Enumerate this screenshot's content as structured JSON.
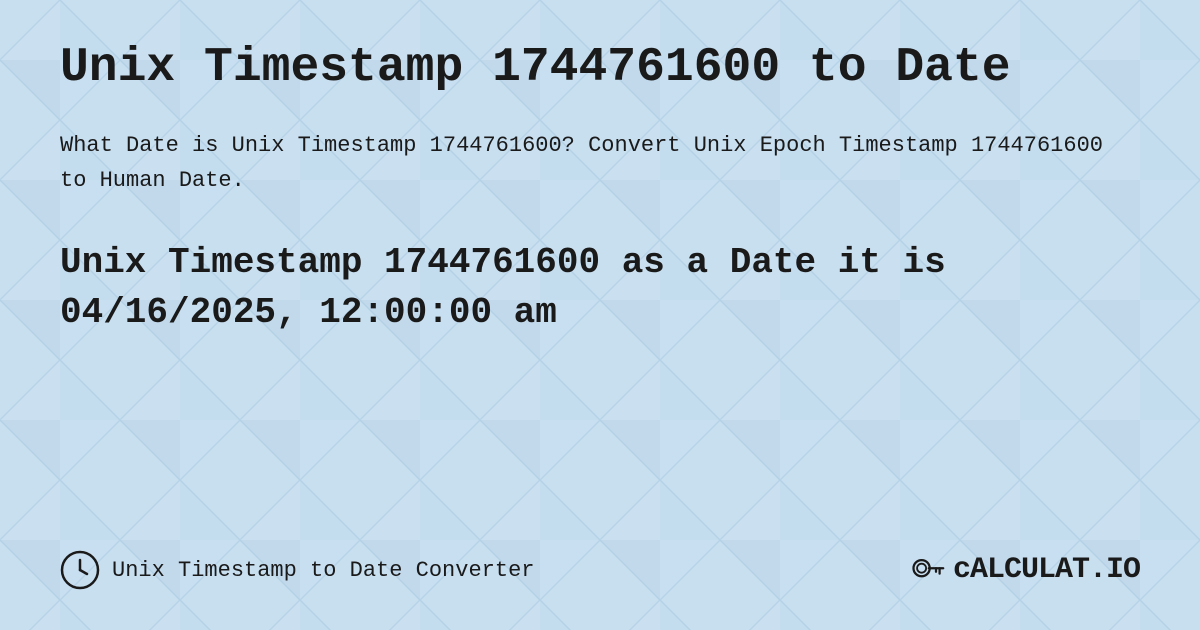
{
  "page": {
    "title": "Unix Timestamp 1744761600 to Date",
    "description": "What Date is Unix Timestamp 1744761600? Convert Unix Epoch Timestamp 1744761600 to Human Date.",
    "result": "Unix Timestamp 1744761600 as a Date it is 04/16/2025, 12:00:00 am",
    "footer_label": "Unix Timestamp to Date Converter",
    "logo_text": "cALCULAT.IO"
  },
  "colors": {
    "background": "#c8dff0",
    "text": "#1a1a1a",
    "diamond_light": "#b8d4e8",
    "diamond_lighter": "#d4e8f5"
  }
}
